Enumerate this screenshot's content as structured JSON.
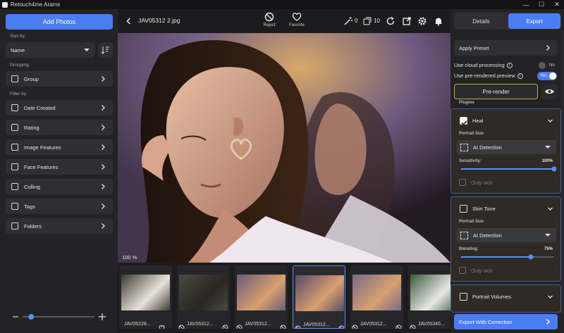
{
  "window": {
    "title": "Retouch4me Arams",
    "minimize": "—",
    "maximize": "☐",
    "close": "✕"
  },
  "left": {
    "add_photos": "Add Photos",
    "sort_by_label": "Sort by:",
    "sort_value": "Name",
    "grouping_label": "Grouping:",
    "group_label": "Group",
    "filter_label": "Filter by:",
    "filters": [
      "Date Created",
      "Rating",
      "Image Features",
      "Face Features",
      "Culling",
      "Tags",
      "Folders"
    ],
    "zoom_slider_value": 0.12
  },
  "topbar": {
    "filename": "JAV05312 2.jpg",
    "reject_label": "Reject",
    "favorite_label": "Favorite",
    "retouch_count": "0",
    "batch_count": "10"
  },
  "viewer": {
    "zoom": "100 %"
  },
  "filmstrip": {
    "thumbs": [
      {
        "name": "JAV05228...",
        "icon": "heart-icon"
      },
      {
        "name": "JAV05312...",
        "icon": "reject-icon"
      },
      {
        "name": "JAV05312...",
        "icon": "reject-icon"
      },
      {
        "name": "JAV05312...",
        "icon": "reject-icon"
      },
      {
        "name": "JAV05312...",
        "icon": "reject-icon"
      },
      {
        "name": "JAV05340...",
        "icon": "reject-icon"
      }
    ],
    "selected_index": 3
  },
  "right": {
    "tab_details": "Details",
    "tab_export": "Export",
    "apply_preset": "Apply Preset",
    "cloud_label": "Use cloud processing",
    "cloud_value": "No",
    "prerendered_label": "Use pre-rendered preview",
    "prerendered_value": "Yes",
    "prerender_btn": "Pre-render",
    "plugins_label": "Plugins",
    "plugins": [
      {
        "name": "Heal",
        "checked": true,
        "portrait_size_label": "Portrait Size",
        "mode": "AI Detection",
        "param_label": "Sensitivity:",
        "param_value": "100%",
        "param": 1.0,
        "only_skin": "Only skin"
      },
      {
        "name": "Skin Tone",
        "checked": false,
        "portrait_size_label": "Portrait Size",
        "mode": "AI Detection",
        "param_label": "Blending:",
        "param_value": "75%",
        "param": 0.75,
        "only_skin": "Only skin"
      },
      {
        "name": "Portrait Volumes",
        "checked": false
      }
    ],
    "export_btn": "Export With Correction"
  },
  "colors": {
    "accent": "#4a7cf4",
    "panel": "#232325",
    "prerender_border": "#c9a63d"
  }
}
